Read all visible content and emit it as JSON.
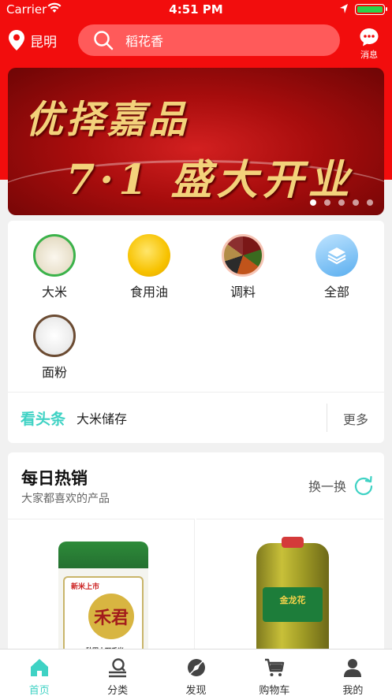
{
  "status": {
    "carrier": "Carrier",
    "time": "4:51 PM"
  },
  "header": {
    "city": "昆明",
    "search_value": "稻花香",
    "message_label": "消息"
  },
  "banner": {
    "line1": "优择嘉品",
    "line2": "7·1 盛大开业",
    "slide_count": 5,
    "active_slide": 1
  },
  "categories": [
    {
      "label": "大米",
      "icon": "rice-icon"
    },
    {
      "label": "食用油",
      "icon": "oil-icon"
    },
    {
      "label": "调料",
      "icon": "spice-icon"
    },
    {
      "label": "全部",
      "icon": "layers-icon"
    },
    {
      "label": "面粉",
      "icon": "flour-icon"
    }
  ],
  "news": {
    "tag": "看头条",
    "text": "大米储存",
    "more": "更多"
  },
  "hot": {
    "title": "每日热销",
    "subtitle": "大家都喜欢的产品",
    "swap_label": "换一换",
    "products": [
      {
        "header_text": "新米上市",
        "brand": "禾君",
        "footer_text": "秋田小町香米"
      },
      {
        "brand": "金龙花"
      }
    ]
  },
  "tabs": [
    {
      "label": "首页",
      "icon": "home-icon",
      "active": true
    },
    {
      "label": "分类",
      "icon": "category-icon",
      "active": false
    },
    {
      "label": "发现",
      "icon": "discover-icon",
      "active": false
    },
    {
      "label": "购物车",
      "icon": "cart-icon",
      "active": false
    },
    {
      "label": "我的",
      "icon": "user-icon",
      "active": false
    }
  ],
  "colors": {
    "brand_red": "#f20d0d",
    "accent_teal": "#3fd2c4"
  }
}
